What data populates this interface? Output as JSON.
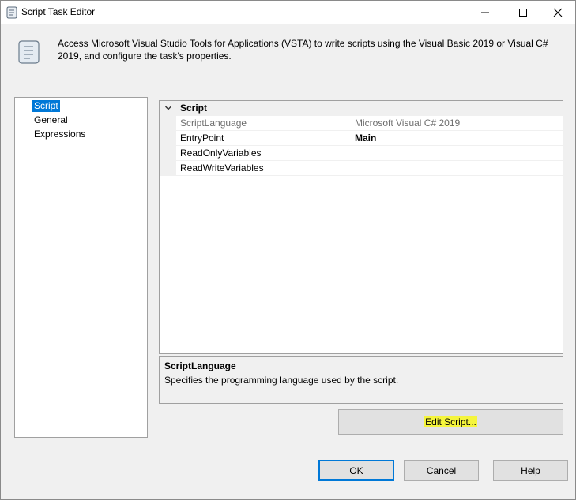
{
  "window": {
    "title": "Script Task Editor",
    "icon": "scroll-icon",
    "controls": [
      "minimize-icon",
      "maximize-icon",
      "close-icon"
    ]
  },
  "header": {
    "icon": "scroll-icon",
    "description": "Access Microsoft Visual Studio Tools for Applications (VSTA) to write scripts using the Visual Basic 2019 or Visual C# 2019, and configure the task's properties."
  },
  "nav": {
    "items": [
      {
        "label": "Script",
        "selected": true
      },
      {
        "label": "General",
        "selected": false
      },
      {
        "label": "Expressions",
        "selected": false
      }
    ]
  },
  "properties": {
    "category": "Script",
    "rows": [
      {
        "name": "ScriptLanguage",
        "value": "Microsoft Visual C# 2019"
      },
      {
        "name": "EntryPoint",
        "value": "Main"
      },
      {
        "name": "ReadOnlyVariables",
        "value": ""
      },
      {
        "name": "ReadWriteVariables",
        "value": ""
      }
    ]
  },
  "description_panel": {
    "title": "ScriptLanguage",
    "text": "Specifies the programming language used by the script."
  },
  "buttons": {
    "edit_script": "Edit Script...",
    "ok": "OK",
    "cancel": "Cancel",
    "help": "Help"
  },
  "colors": {
    "selection": "#0078d7",
    "highlight": "#f5f53c"
  }
}
